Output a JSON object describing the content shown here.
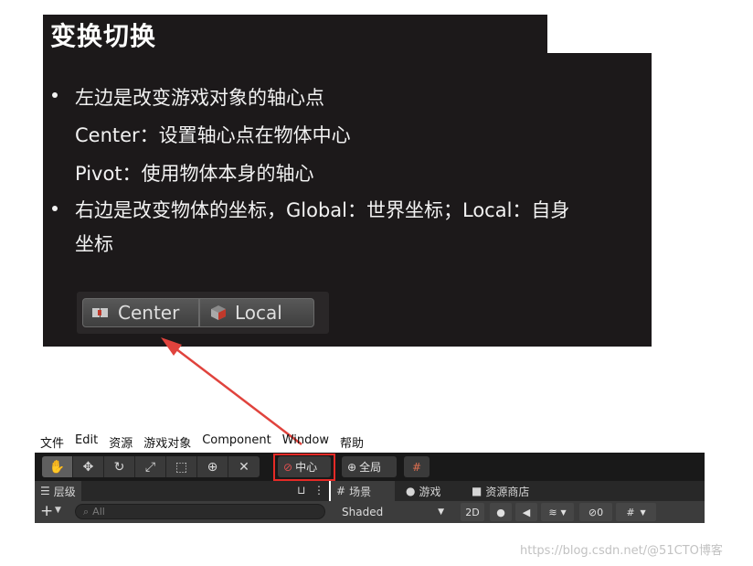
{
  "slide": {
    "title": "变换切换",
    "lines": [
      "左边是改变游戏对象的轴心点",
      "Center：设置轴心点在物体中心",
      "Pivot：使用物体本身的轴心",
      "右边是改变物体的坐标，Global：世界坐标；Local：自身",
      "坐标"
    ],
    "pivot_buttons": {
      "left": "Center",
      "right": "Local"
    }
  },
  "menubar": [
    "文件",
    "Edit",
    "资源",
    "游戏对象",
    "Component",
    "Window",
    "帮助"
  ],
  "toolbar": {
    "pivot_label": "中心",
    "global_label": "全局"
  },
  "hierarchy": {
    "tab_label": "层级",
    "add_label": "+",
    "search_placeholder": "All",
    "lock_glyph": "🔒",
    "more_glyph": "⋮"
  },
  "tabs": {
    "scene": "场景",
    "game": "游戏",
    "store": "资源商店"
  },
  "scene_toolbar": {
    "shading_mode": "Shaded",
    "mode_2d": "2D",
    "hidden_count": "0"
  },
  "watermark": "https://blog.csdn.net/@51CTO博客",
  "colors": {
    "highlight": "#e52a26",
    "arrow": "#e0433d",
    "toolbar_bg": "#191919"
  }
}
